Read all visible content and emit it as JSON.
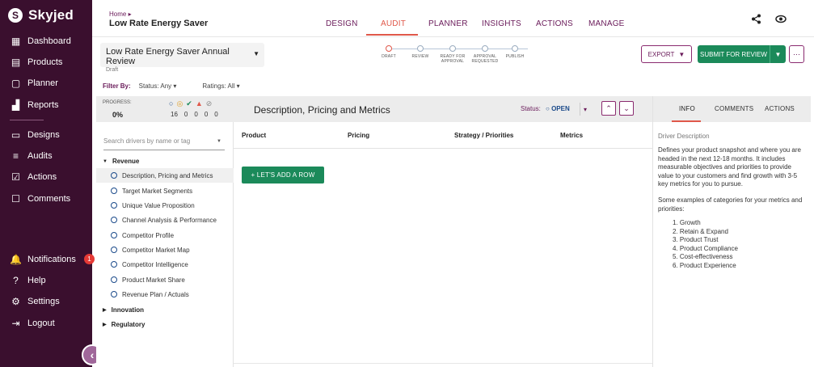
{
  "app": {
    "name": "Skyjed",
    "logo": "S"
  },
  "sidebar": {
    "items": [
      {
        "label": "Dashboard",
        "icon": "dashboard-icon",
        "glyph": "▦"
      },
      {
        "label": "Products",
        "icon": "products-icon",
        "glyph": "▤"
      },
      {
        "label": "Planner",
        "icon": "planner-icon",
        "glyph": "▢"
      },
      {
        "label": "Reports",
        "icon": "reports-icon",
        "glyph": "▟"
      },
      {
        "label": "Designs",
        "icon": "designs-icon",
        "glyph": "▭"
      },
      {
        "label": "Audits",
        "icon": "audits-icon",
        "glyph": "≡"
      },
      {
        "label": "Actions",
        "icon": "actions-icon",
        "glyph": "☑"
      },
      {
        "label": "Comments",
        "icon": "comments-icon",
        "glyph": "☐"
      }
    ],
    "bottom": [
      {
        "label": "Notifications",
        "icon": "bell-icon",
        "glyph": "♫",
        "badge": "1"
      },
      {
        "label": "Help",
        "icon": "help-icon",
        "glyph": "?"
      },
      {
        "label": "Settings",
        "icon": "gear-icon",
        "glyph": "⚙"
      },
      {
        "label": "Logout",
        "icon": "logout-icon",
        "glyph": "⇥"
      }
    ],
    "collapse_glyph": "‹"
  },
  "header": {
    "breadcrumb": "Home ▸",
    "title": "Low Rate Energy Saver",
    "tabs": [
      "DESIGN",
      "AUDIT",
      "PLANNER",
      "INSIGHTS",
      "ACTIONS",
      "MANAGE"
    ],
    "active_tab": "AUDIT"
  },
  "review": {
    "title": "Low Rate Energy Saver Annual Review",
    "status": "Draft",
    "steps": [
      "DRAFT",
      "REVIEW",
      "READY FOR APPROVAL",
      "APPROVAL REQUESTED",
      "PUBLISH"
    ],
    "export_label": "EXPORT",
    "submit_label": "SUBMIT FOR REVIEW",
    "more_label": "⋯"
  },
  "filters": {
    "label": "Filter By:",
    "status": "Status: Any",
    "ratings": "Ratings: All"
  },
  "progress": {
    "label": "PROGRESS:",
    "value": "0%",
    "counts": [
      "16",
      "0",
      "0",
      "0",
      "0"
    ]
  },
  "section": {
    "title": "Description, Pricing and Metrics",
    "status_label": "Status:",
    "status_value": "OPEN"
  },
  "tree": {
    "search_placeholder": "Search drivers by name or tag",
    "groups": [
      {
        "label": "Revenue",
        "expanded": true
      },
      {
        "label": "Innovation",
        "expanded": false
      },
      {
        "label": "Regulatory",
        "expanded": false
      }
    ],
    "items": [
      "Description, Pricing and Metrics",
      "Target Market Segments",
      "Unique Value Proposition",
      "Channel Analysis & Performance",
      "Competitor Profile",
      "Competitor Market Map",
      "Competitor Intelligence",
      "Product Market Share",
      "Revenue Plan / Actuals"
    ],
    "selected": 0
  },
  "table": {
    "columns": [
      "Product",
      "Pricing",
      "Strategy / Priorities",
      "Metrics"
    ],
    "add_row_label": "+ LET'S ADD A ROW"
  },
  "right_panel": {
    "tabs": [
      "INFO",
      "COMMENTS",
      "ACTIONS"
    ],
    "active_tab": "INFO",
    "section_title": "Driver Description",
    "description": "Defines your product snapshot and where you are headed in the next 12-18 months. It includes measurable objectives and priorities to provide value to your customers and find growth with 3-5 key metrics for you to pursue.",
    "examples_intro": "Some examples of categories for your metrics and priorities:",
    "examples": [
      "1. Growth",
      "2. Retain & Expand",
      "3. Product Trust",
      "4. Product Compliance",
      "5. Cost-effectiveness",
      "6. Product Experience"
    ]
  },
  "colors": {
    "sidebar_bg": "#3a0f2e",
    "brand_purple": "#6a1b5a",
    "accent_orange": "#e0584a",
    "green": "#1b8a5a"
  }
}
